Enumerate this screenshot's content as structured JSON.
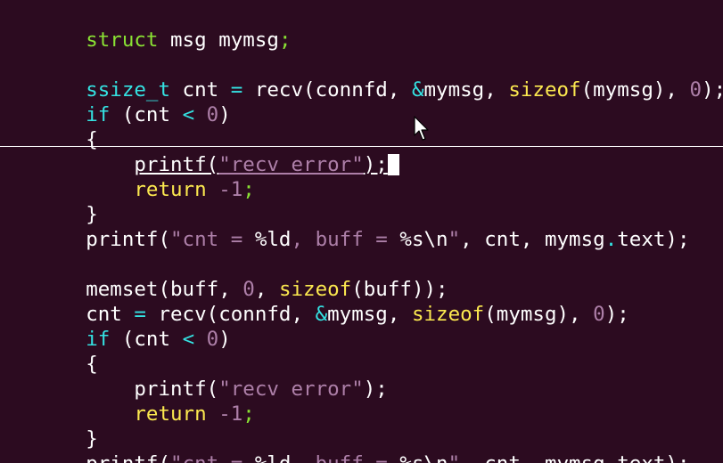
{
  "lines": [
    {
      "t": "struct msg mymsg;"
    },
    {
      "t": ""
    },
    {
      "t": "ssize_t cnt = recv(connfd, &mymsg, sizeof(mymsg), 0);"
    },
    {
      "t": "if (cnt < 0)"
    },
    {
      "t": "{"
    },
    {
      "t": "    printf(\"recv error\");"
    },
    {
      "t": "    return -1;"
    },
    {
      "t": "}"
    },
    {
      "t": "printf(\"cnt = %ld, buff = %s\\n\", cnt, mymsg.text);"
    },
    {
      "t": ""
    },
    {
      "t": "memset(buff, 0, sizeof(buff));"
    },
    {
      "t": "cnt = recv(connfd, &mymsg, sizeof(mymsg), 0);"
    },
    {
      "t": "if (cnt < 0)"
    },
    {
      "t": "{"
    },
    {
      "t": "    printf(\"recv error\");"
    },
    {
      "t": "    return -1;"
    },
    {
      "t": "}"
    },
    {
      "t": "printf(\"cnt = %ld, buff = %s\\n\", cnt, mymsg.text);"
    }
  ],
  "tokens": {
    "l0": [
      "struct",
      " msg mymsg",
      ";"
    ],
    "l2": [
      "ssize_t",
      " cnt ",
      "=",
      " recv(connfd, ",
      "&",
      "mymsg, ",
      "sizeof",
      "(mymsg), ",
      "0",
      ");"
    ],
    "l3": [
      "if",
      " (cnt ",
      "<",
      " ",
      "0",
      ")"
    ],
    "l4": [
      "{"
    ],
    "l5": [
      "    ",
      "printf(",
      "\"recv error\"",
      ");"
    ],
    "l6": [
      "    ",
      "return",
      " ",
      "-1",
      ";"
    ],
    "l7": [
      "}"
    ],
    "l8": [
      "printf(",
      "\"cnt = ",
      "%ld",
      ", buff = ",
      "%s\\n",
      "\"",
      ", cnt, mymsg",
      ".",
      "text);"
    ],
    "l10": [
      "memset(buff, ",
      "0",
      ", ",
      "sizeof",
      "(buff));"
    ],
    "l11": [
      "cnt ",
      "=",
      " recv(connfd, ",
      "&",
      "mymsg, ",
      "sizeof",
      "(mymsg), ",
      "0",
      ");"
    ],
    "l12": [
      "if",
      " (cnt ",
      "<",
      " ",
      "0",
      ")"
    ],
    "l13": [
      "{"
    ],
    "l14": [
      "    ",
      "printf(",
      "\"recv error\"",
      ");"
    ],
    "l15": [
      "    ",
      "return",
      " ",
      "-1",
      ";"
    ],
    "l16": [
      "}"
    ],
    "l17": [
      "printf(",
      "\"cnt = ",
      "%ld",
      ", buff = ",
      "%s\\n",
      "\"",
      ", cnt, mymsg",
      ".",
      "text);"
    ]
  },
  "colors": {
    "background": "#2c0b20",
    "text": "#ffffff",
    "keyword_green": "#8ae234",
    "type_cyan": "#34e2e2",
    "func_yellow": "#fce94f",
    "literal_purple": "#ad7fa8"
  },
  "icons": {
    "mouse": "mouse-pointer-icon",
    "cursor": "text-cursor-block"
  }
}
